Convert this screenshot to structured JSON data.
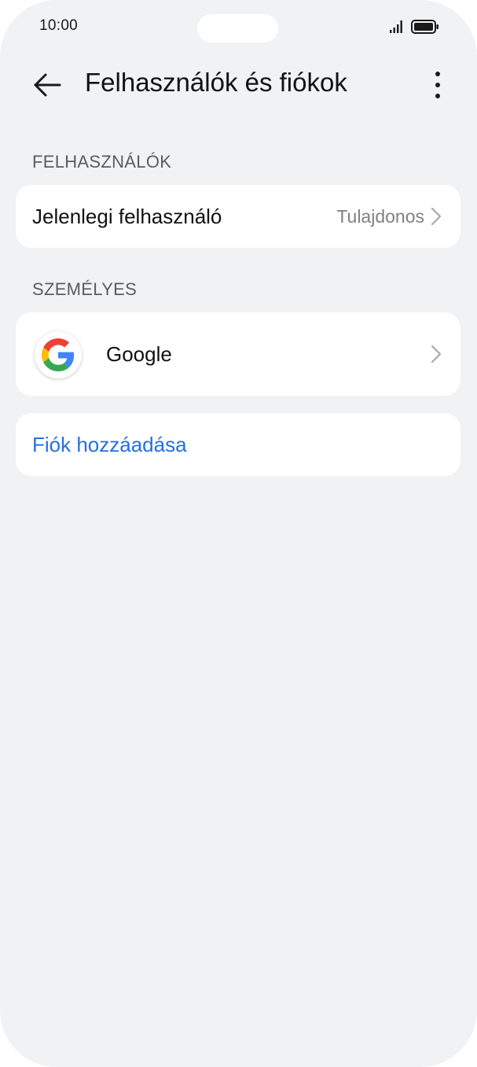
{
  "status_bar": {
    "time": "10:00",
    "icons": [
      "signal-icon",
      "battery-icon"
    ]
  },
  "header": {
    "title": "Felhasználók és fiókok",
    "back_icon": "arrow-left-icon",
    "more_icon": "more-vertical-icon"
  },
  "users_section": {
    "header": "FELHASZNÁLÓK",
    "current_user": {
      "label": "Jelenlegi felhasználó",
      "value": "Tulajdonos"
    }
  },
  "personal_section": {
    "header": "SZEMÉLYES",
    "accounts": [
      {
        "label": "Google",
        "icon": "google-icon"
      }
    ]
  },
  "add_account": {
    "label": "Fiók hozzáadása"
  },
  "colors": {
    "background": "#f1f2f4",
    "card": "#ffffff",
    "accent": "#256fe0",
    "google_blue": "#4285F4",
    "google_red": "#EA4335",
    "google_yellow": "#FBBC05",
    "google_green": "#34A853"
  }
}
